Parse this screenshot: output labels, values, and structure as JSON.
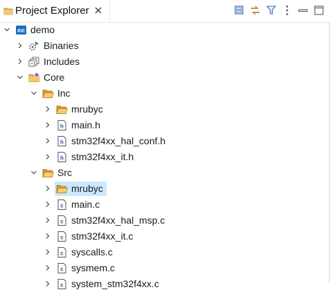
{
  "view": {
    "tab_title": "Project Explorer",
    "toolbar": [
      "collapse-all-icon",
      "link-with-editor-icon",
      "filter-icon",
      "view-menu-icon",
      "minimize-icon",
      "maximize-icon"
    ]
  },
  "tree": {
    "project": {
      "label": "demo",
      "badge": "IDE"
    },
    "binaries": "Binaries",
    "includes": "Includes",
    "core": "Core",
    "inc": "Inc",
    "inc_mrubyc": "mrubyc",
    "main_h": "main.h",
    "hal_conf_h": "stm32f4xx_hal_conf.h",
    "it_h": "stm32f4xx_it.h",
    "src": "Src",
    "src_mrubyc": "mrubyc",
    "main_c": "main.c",
    "hal_msp_c": "stm32f4xx_hal_msp.c",
    "it_c": "stm32f4xx_it.c",
    "syscalls_c": "syscalls.c",
    "sysmem_c": "sysmem.c",
    "system_c": "system_stm32f4xx.c"
  },
  "colors": {
    "folder": "#e8b04a",
    "selection": "#cce8ff",
    "accent": "#1b6ec2"
  }
}
